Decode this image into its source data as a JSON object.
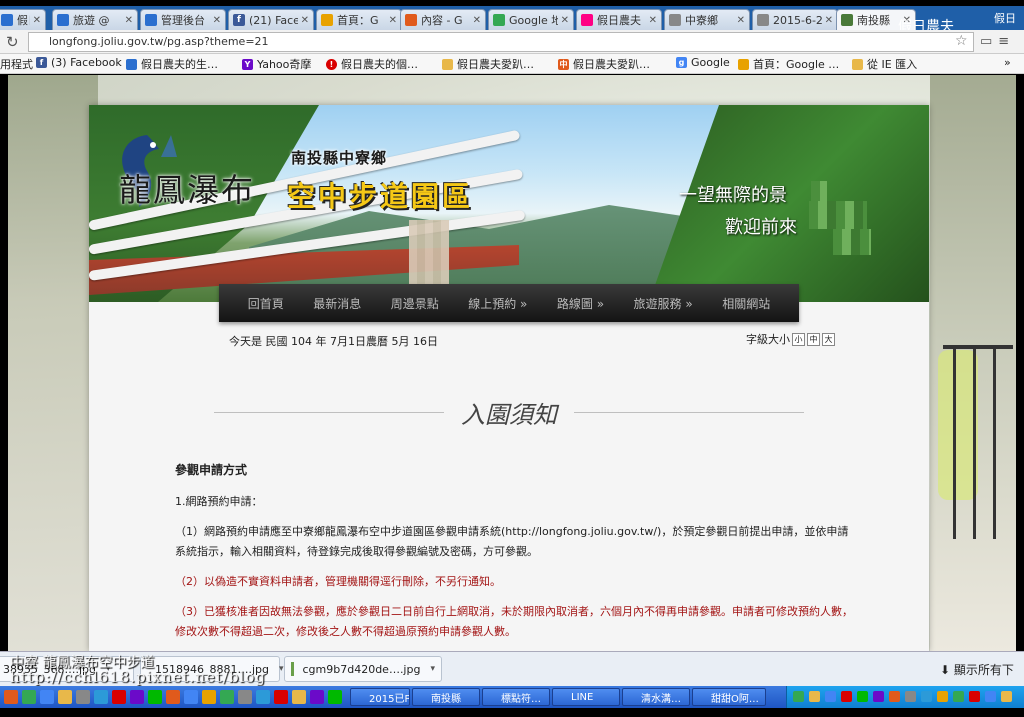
{
  "window": {
    "title": "假日農夫",
    "corner": "假日"
  },
  "tabs": [
    {
      "label": "假日農",
      "color": "#2b6fcf"
    },
    {
      "label": "旅遊 @",
      "color": "#2b6fcf"
    },
    {
      "label": "管理後台",
      "color": "#2b6fcf"
    },
    {
      "label": "(21) Face",
      "color": "#3b5998"
    },
    {
      "label": "首頁：G",
      "color": "#e8a200"
    },
    {
      "label": "內容 - G",
      "color": "#e05a1c"
    },
    {
      "label": "Google 地",
      "color": "#34a853"
    },
    {
      "label": "假日農夫",
      "color": "#ff0084"
    },
    {
      "label": "中寮鄉",
      "color": "#888888"
    },
    {
      "label": "2015-6-2",
      "color": "#888888"
    },
    {
      "label": "南投縣",
      "color": "#4a7a3a"
    }
  ],
  "address": {
    "url": "longfong.joliu.gov.tw/pg.asp?theme=21"
  },
  "bookmarks": [
    {
      "label": "應用程式",
      "icon": "apps-icon",
      "color": "#4285f4"
    },
    {
      "label": "(3) Facebook",
      "icon": "facebook-icon",
      "color": "#3b5998"
    },
    {
      "label": "假日農夫的生…",
      "icon": "blog-icon",
      "color": "#2b6fcf"
    },
    {
      "label": "Yahoo奇摩",
      "icon": "yahoo-icon",
      "color": "#6b0ac9"
    },
    {
      "label": "假日農夫的個…",
      "icon": "pixnet-icon",
      "color": "#d90000"
    },
    {
      "label": "假日農夫愛趴…",
      "icon": "folder-icon",
      "color": "#e8b84a"
    },
    {
      "label": "假日農夫愛趴…",
      "icon": "chinatimes-icon",
      "color": "#e05a1c"
    },
    {
      "label": "Google",
      "icon": "google-icon",
      "color": "#4285f4"
    },
    {
      "label": "首頁：Google …",
      "icon": "drive-icon",
      "color": "#e8a200"
    },
    {
      "label": "從 IE 匯入",
      "icon": "folder-icon",
      "color": "#e8b84a"
    }
  ],
  "site": {
    "county": "南投縣中寮鄉",
    "name": "龍鳳瀑布",
    "park": "空中步道園區",
    "slogan1": "一望無際的景",
    "slogan2": "歡迎前來",
    "nav": [
      "回首頁",
      "最新消息",
      "周邊景點",
      "線上預約 »",
      "路線圖 »",
      "旅遊服務 »",
      "相關網站"
    ],
    "date": "今天是 民國 104 年 7月1日農曆 5月 16日",
    "fontsize_label": "字級大小",
    "fontsize_buttons": [
      "小",
      "中",
      "大"
    ],
    "heading": "入園須知",
    "subheading": "參觀申請方式",
    "item1": "1.網路預約申請：",
    "para1": "（1）網路預約申請應至中寮鄉龍鳳瀑布空中步道園區參觀申請系統(http://longfong.joliu.gov.tw/)，於預定參觀日前提出申請，並依申請系統指示，輸入相關資料，待登錄完成後取得參觀編號及密碼，方可參觀。",
    "para2": "（2）以偽造不實資料申請者，管理機關得逕行刪除，不另行通知。",
    "para3": "（3）已獲核准者因故無法參觀，應於參觀日二日前自行上網取消，未於期限內取消者，六個月內不得再申請參觀。申請者可修改預約人數，修改次數不得超過二次，修改後之人數不得超過原預約申請參觀人數。"
  },
  "downloads": [
    {
      "label": "38955_368….jpg"
    },
    {
      "label": "1518946_8881….jpg"
    },
    {
      "label": "cgm9b7d420de….jpg"
    }
  ],
  "show_all": "顯示所有下",
  "watermark_line1": "中寮 龍鳳瀑布空中步道",
  "watermark_line2": "http://cchl618.pixnet.net/blog",
  "taskbar": [
    {
      "label": "2015已PO",
      "color": "#e8b84a"
    },
    {
      "label": "南投縣",
      "color": "#4285f4"
    },
    {
      "label": "標點符…",
      "color": "#2c9ad8"
    },
    {
      "label": "LINE",
      "color": "#00b900"
    },
    {
      "label": "清水溝…",
      "color": "#e05a1c"
    },
    {
      "label": "甜甜O阿…",
      "color": "#e8b84a"
    }
  ]
}
